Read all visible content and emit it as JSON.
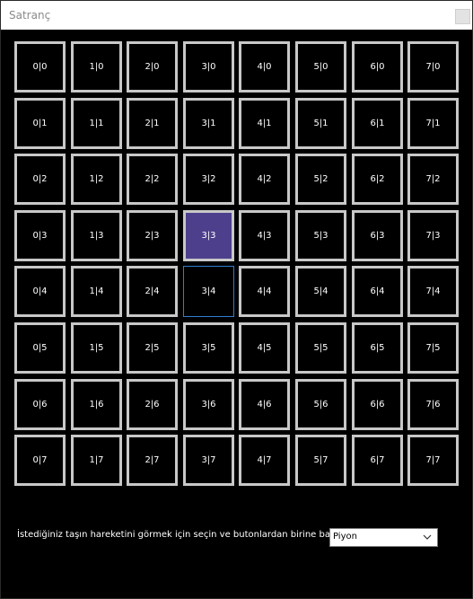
{
  "window": {
    "title": "Satranç"
  },
  "board": {
    "columns": 8,
    "rows": 8,
    "cells": [
      [
        "0|0",
        "1|0",
        "2|0",
        "3|0",
        "4|0",
        "5|0",
        "6|0",
        "7|0"
      ],
      [
        "0|1",
        "1|1",
        "2|1",
        "3|1",
        "4|1",
        "5|1",
        "6|1",
        "7|1"
      ],
      [
        "0|2",
        "1|2",
        "2|2",
        "3|2",
        "4|2",
        "5|2",
        "6|2",
        "7|2"
      ],
      [
        "0|3",
        "1|3",
        "2|3",
        "3|3",
        "4|3",
        "5|3",
        "6|3",
        "7|3"
      ],
      [
        "0|4",
        "1|4",
        "2|4",
        "3|4",
        "4|4",
        "5|4",
        "6|4",
        "7|4"
      ],
      [
        "0|5",
        "1|5",
        "2|5",
        "3|5",
        "4|5",
        "5|5",
        "6|5",
        "7|5"
      ],
      [
        "0|6",
        "1|6",
        "2|6",
        "3|6",
        "4|6",
        "5|6",
        "6|6",
        "7|6"
      ],
      [
        "0|7",
        "1|7",
        "2|7",
        "3|7",
        "4|7",
        "5|7",
        "6|7",
        "7|7"
      ]
    ],
    "selected_cell": "3|3",
    "focused_cell": "3|4",
    "colors": {
      "cell_background": "#000000",
      "cell_border": "#c8c8c8",
      "selected_background": "#4e3f8c",
      "focus_border": "#2e7fd0"
    }
  },
  "controls": {
    "prompt": "İstediğiniz taşın hareketini görmek için seçin ve butonlardan birine basın:",
    "piece_select": {
      "value": "Piyon",
      "icon": "chevron-down-icon"
    }
  }
}
